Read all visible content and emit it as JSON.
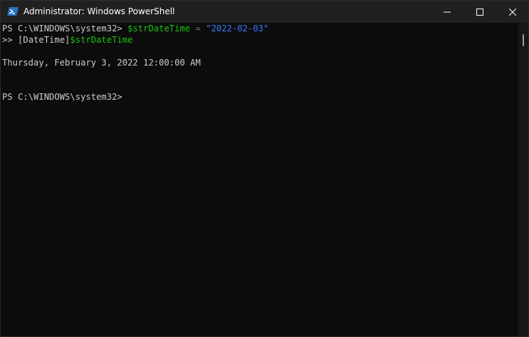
{
  "window": {
    "title": "Administrator: Windows PowerShell",
    "app_icon": "powershell-icon",
    "controls": {
      "minimize_icon": "minimize-icon",
      "maximize_icon": "maximize-icon",
      "close_icon": "close-icon"
    }
  },
  "colors": {
    "background": "#0c0c0c",
    "titlebar": "#202020",
    "text": "#cccccc",
    "variable": "#16c60c",
    "string": "#3b78ff",
    "operator": "#767676"
  },
  "terminal": {
    "line1": {
      "prompt": "PS C:\\WINDOWS\\system32> ",
      "variable": "$strDateTime",
      "operator": " = ",
      "string": "\"2022-02-03\""
    },
    "line2": {
      "prompt": ">> ",
      "type": "[DateTime]",
      "variable": "$strDateTime"
    },
    "output": "Thursday, February 3, 2022 12:00:00 AM",
    "line_final": {
      "prompt": "PS C:\\WINDOWS\\system32>"
    }
  }
}
